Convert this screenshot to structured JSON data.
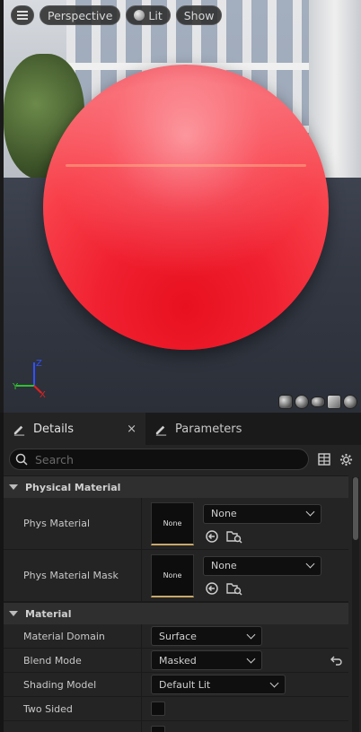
{
  "viewport": {
    "toolbar": {
      "perspective_label": "Perspective",
      "lit_label": "Lit",
      "show_label": "Show"
    },
    "axis_labels": {
      "z": "Z",
      "y": "Y",
      "x": "X"
    },
    "preview_shapes": [
      "cylinder-icon",
      "sphere-icon",
      "plane-icon",
      "cube-icon",
      "teapot-icon"
    ]
  },
  "details": {
    "tabs": [
      {
        "label": "Details",
        "close": "×"
      },
      {
        "label": "Parameters"
      }
    ],
    "search": {
      "placeholder": "Search"
    },
    "sections": {
      "physical_material": {
        "title": "Physical Material",
        "phys_material": {
          "label": "Phys Material",
          "thumb": "None",
          "value": "None"
        },
        "phys_material_mask": {
          "label": "Phys Material Mask",
          "thumb": "None",
          "value": "None"
        }
      },
      "material": {
        "title": "Material",
        "material_domain": {
          "label": "Material Domain",
          "value": "Surface"
        },
        "blend_mode": {
          "label": "Blend Mode",
          "value": "Masked"
        },
        "shading_model": {
          "label": "Shading Model",
          "value": "Default Lit"
        },
        "two_sided": {
          "label": "Two Sided",
          "checked": false
        }
      }
    }
  },
  "colors": {
    "accent_thumb_border": "#c8a86a",
    "axis_x": "#e02020",
    "axis_y": "#30c030",
    "axis_z": "#3050ff"
  }
}
